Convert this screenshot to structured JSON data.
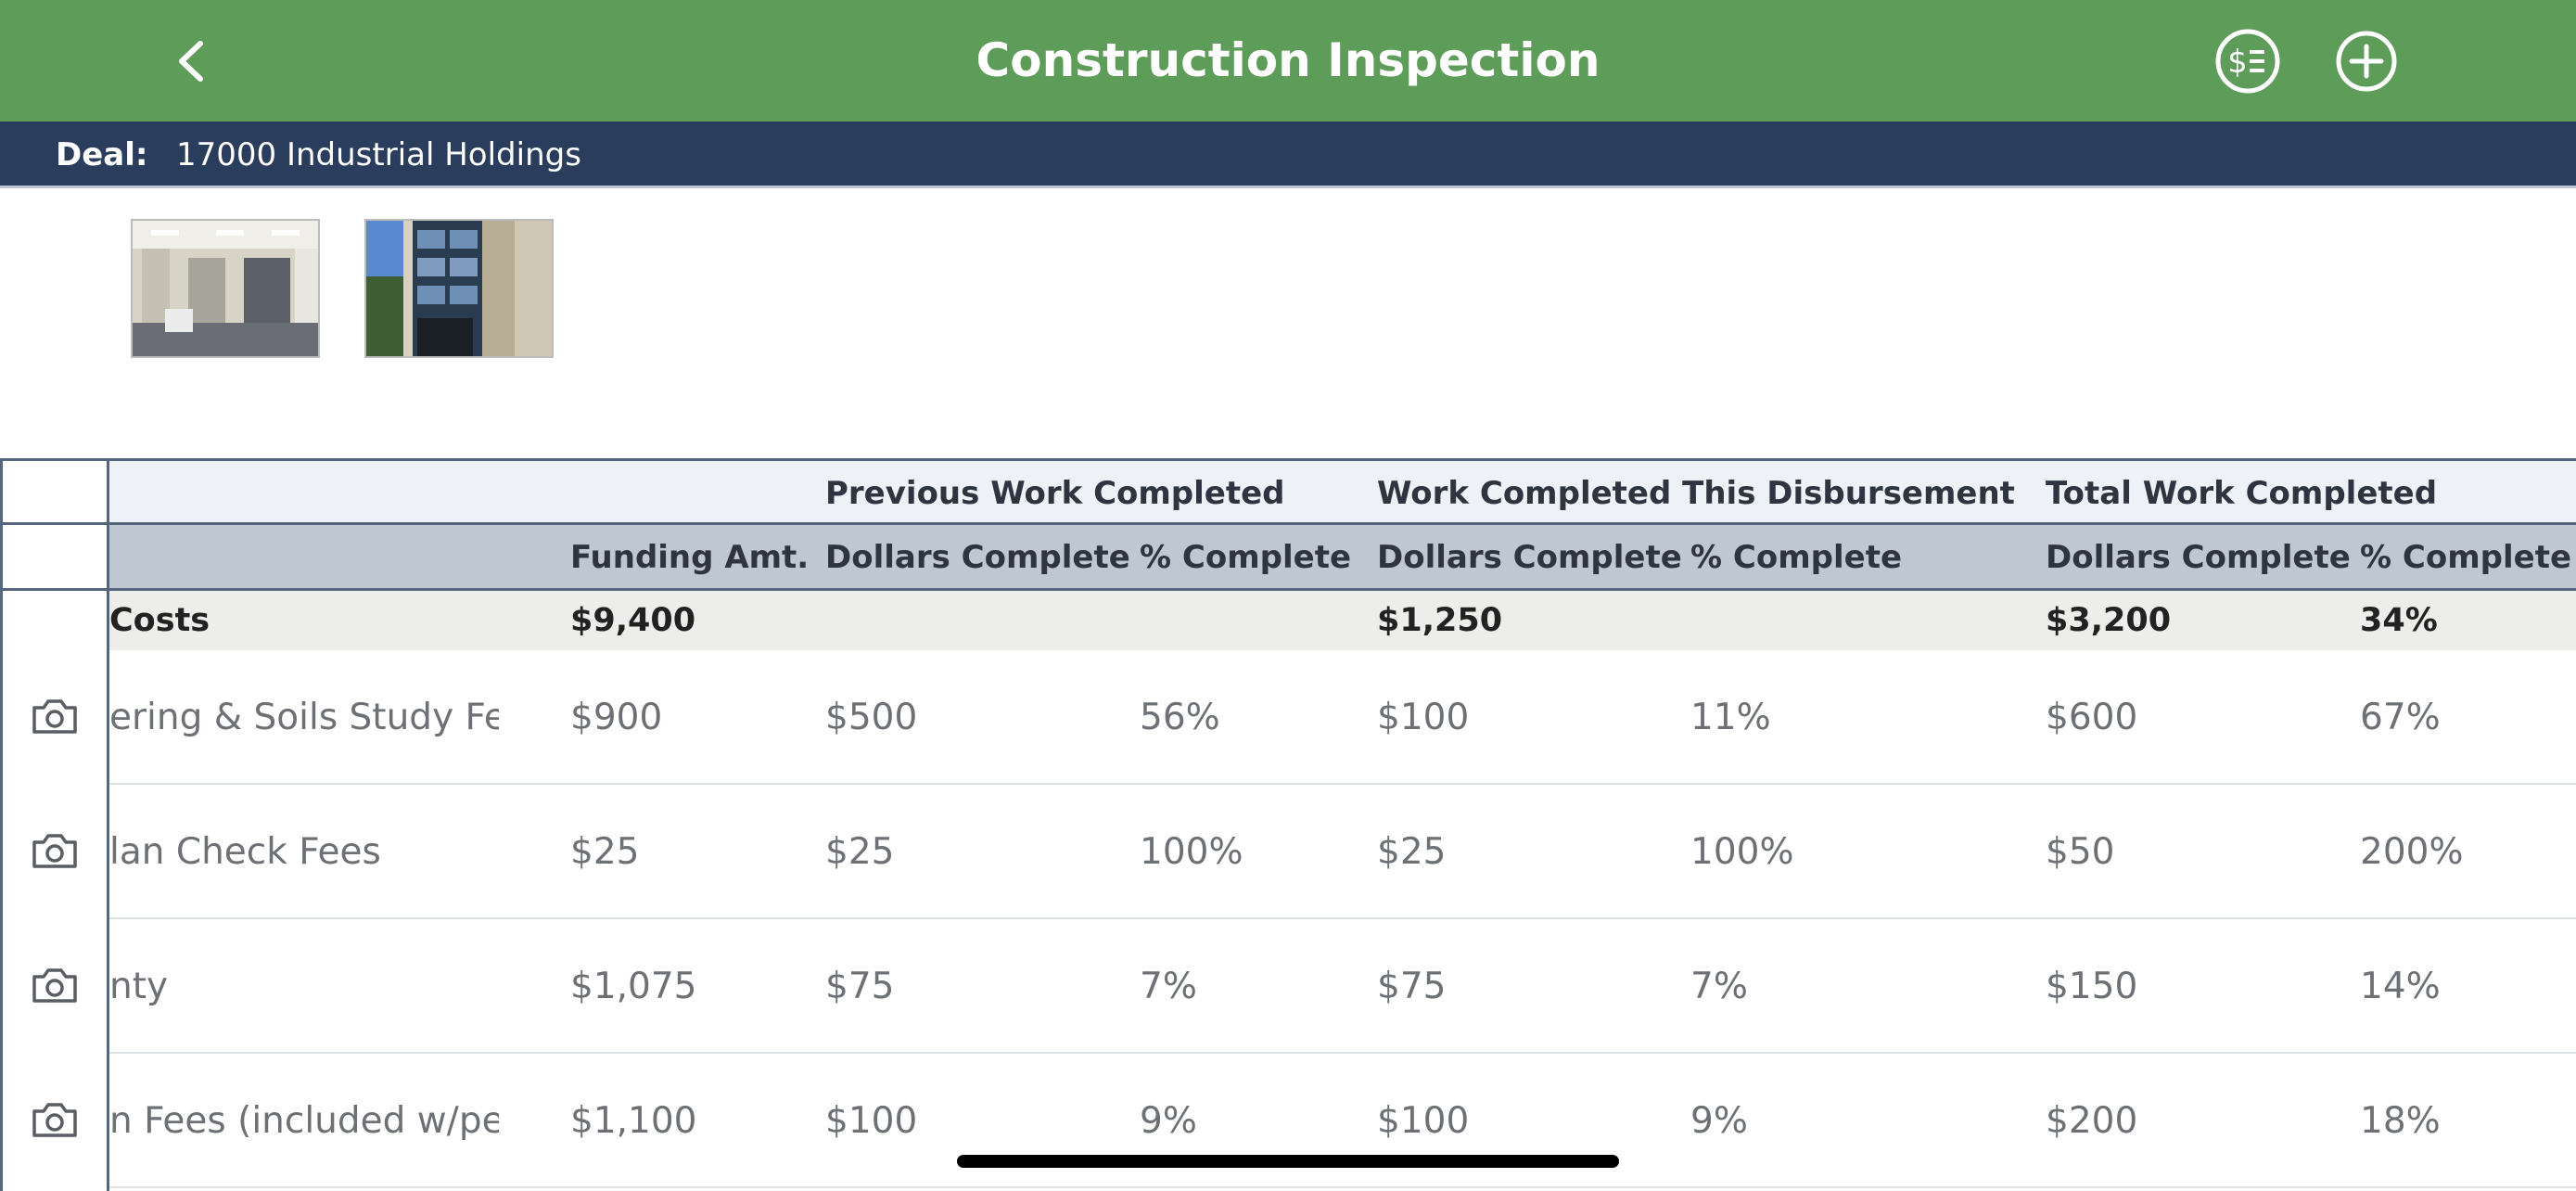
{
  "header": {
    "title": "Construction Inspection",
    "back_icon": "chevron-left-icon",
    "disbursement_icon": "dollar-list-icon",
    "add_icon": "plus-circle-icon",
    "background_color": "#5e9c59"
  },
  "deal": {
    "label": "Deal:",
    "value": "17000 Industrial Holdings",
    "background_color": "#2b3d5c"
  },
  "photos": [
    {
      "name": "interior-office-photo"
    },
    {
      "name": "building-exterior-photo"
    }
  ],
  "table": {
    "group_headers": {
      "previous": "Previous Work Completed",
      "this_disbursement": "Work Completed This Disbursement",
      "total": "Total Work Completed"
    },
    "columns": {
      "funding": "Funding Amt.",
      "prev_dollars": "Dollars Complete",
      "prev_pct": "% Complete",
      "this_dollars": "Dollars Complete",
      "this_pct": "% Complete",
      "total_dollars": "Dollars Complete",
      "total_pct": "% Complete"
    },
    "summary": {
      "desc": "Costs",
      "funding": "$9,400",
      "prev_dollars": "",
      "prev_pct": "",
      "this_dollars": "$1,250",
      "this_pct": "",
      "total_dollars": "$3,200",
      "total_pct": "34%"
    },
    "rows": [
      {
        "desc": "ering & Soils Study Fees",
        "funding": "$900",
        "prev_dollars": "$500",
        "prev_pct": "56%",
        "this_dollars": "$100",
        "this_pct": "11%",
        "total_dollars": "$600",
        "total_pct": "67%"
      },
      {
        "desc": "lan Check Fees",
        "funding": "$25",
        "prev_dollars": "$25",
        "prev_pct": "100%",
        "this_dollars": "$25",
        "this_pct": "100%",
        "total_dollars": "$50",
        "total_pct": "200%"
      },
      {
        "desc": "nty",
        "funding": "$1,075",
        "prev_dollars": "$75",
        "prev_pct": "7%",
        "this_dollars": "$75",
        "this_pct": "7%",
        "total_dollars": "$150",
        "total_pct": "14%"
      },
      {
        "desc": "n Fees (included w/permi...",
        "funding": "$1,100",
        "prev_dollars": "$100",
        "prev_pct": "9%",
        "this_dollars": "$100",
        "this_pct": "9%",
        "total_dollars": "$200",
        "total_pct": "18%"
      }
    ],
    "row_icon": "camera-icon"
  }
}
